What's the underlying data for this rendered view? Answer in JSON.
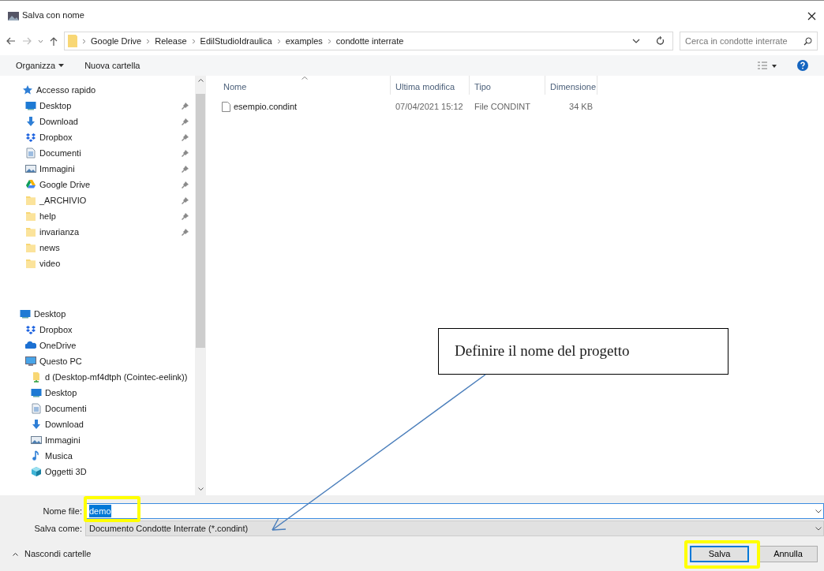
{
  "window": {
    "title": "Salva con nome"
  },
  "breadcrumb": [
    "Google Drive",
    "Release",
    "EdilStudioIdraulica",
    "examples",
    "condotte interrate"
  ],
  "search": {
    "placeholder": "Cerca in condotte interrate"
  },
  "toolbar": [
    {
      "label": "Organizza",
      "dropdown": true
    },
    {
      "label": "Nuova cartella",
      "dropdown": false
    }
  ],
  "sidebar": {
    "items": [
      {
        "label": "Accesso rapido",
        "kind": "star",
        "children": [
          {
            "label": "Desktop",
            "kind": "desktop",
            "pinned": true
          },
          {
            "label": "Download",
            "kind": "download",
            "pinned": true
          },
          {
            "label": "Dropbox",
            "kind": "dropbox",
            "pinned": true
          },
          {
            "label": "Documenti",
            "kind": "documents",
            "pinned": true
          },
          {
            "label": "Immagini",
            "kind": "images",
            "pinned": true
          },
          {
            "label": "Google Drive",
            "kind": "gdrive",
            "pinned": true
          },
          {
            "label": "_ARCHIVIO",
            "kind": "folder",
            "pinned": true
          },
          {
            "label": "help",
            "kind": "folder",
            "pinned": true
          },
          {
            "label": "invarianza",
            "kind": "folder",
            "pinned": true
          },
          {
            "label": "news",
            "kind": "folder",
            "pinned": false
          },
          {
            "label": "video",
            "kind": "folder",
            "pinned": false
          }
        ]
      },
      {
        "label": "Desktop",
        "kind": "desktop",
        "children": [
          {
            "label": "Dropbox",
            "kind": "dropbox"
          },
          {
            "label": "OneDrive",
            "kind": "onedrive"
          },
          {
            "label": "Questo PC",
            "kind": "pc",
            "children": [
              {
                "label": "d (Desktop-mf4dtph (Cointec-eelink))",
                "kind": "netdrive"
              },
              {
                "label": "Desktop",
                "kind": "desktop"
              },
              {
                "label": "Documenti",
                "kind": "documents"
              },
              {
                "label": "Download",
                "kind": "download"
              },
              {
                "label": "Immagini",
                "kind": "images"
              },
              {
                "label": "Musica",
                "kind": "music"
              },
              {
                "label": "Oggetti 3D",
                "kind": "cube"
              }
            ]
          }
        ]
      }
    ]
  },
  "table": {
    "columns": [
      {
        "label": "Nome",
        "sorted": true
      },
      {
        "label": "Ultima modifica",
        "sorted": false
      },
      {
        "label": "Tipo",
        "sorted": false
      },
      {
        "label": "Dimensione",
        "sorted": false
      }
    ],
    "rows": [
      {
        "name": "esempio.condint",
        "modified": "07/04/2021 15:12",
        "type": "File CONDINT",
        "size": "34 KB"
      }
    ]
  },
  "filename": {
    "label": "Nome file:",
    "value": "demo",
    "text_selected": true
  },
  "save_as": {
    "label": "Salva come:",
    "value": "Documento Condotte Interrate (*.condint)"
  },
  "hide_folders": "Nascondi cartelle",
  "buttons": [
    {
      "label": "Salva",
      "default": true
    },
    {
      "label": "Annulla",
      "default": false
    }
  ],
  "annotation": {
    "text": "Definire il nome del progetto"
  }
}
